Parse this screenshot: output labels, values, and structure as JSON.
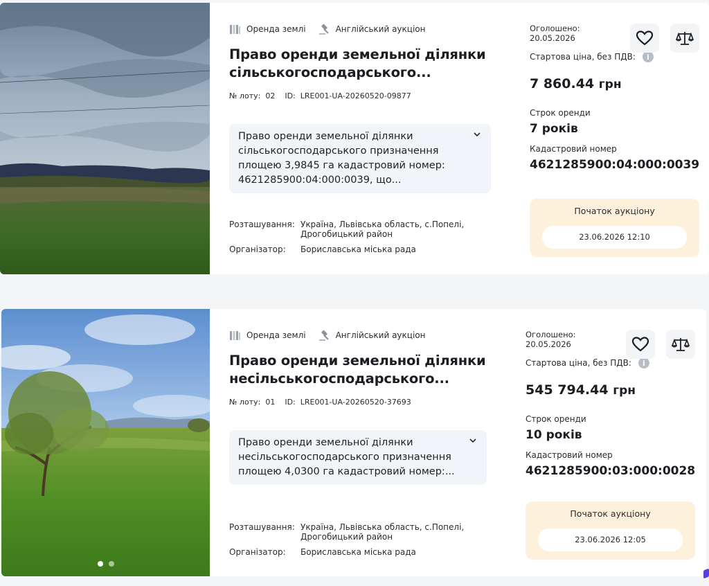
{
  "lots": [
    {
      "category": "Оренда землі",
      "auction_type": "Англійський аукціон",
      "title_line1": "Право оренди земельної ділянки",
      "title_line2": "сільськогосподарського...",
      "lot_label": "№ лоту:",
      "lot_number": "02",
      "id_label": "ID:",
      "id_value": "LRE001-UA-20260520-09877",
      "description": "Право оренди земельної ділянки сільськогосподарського призначення площею 3,9845 га кадастровий номер: 4621285900:04:000:0039, що...",
      "location_label": "Розташування:",
      "location_line1": "Україна, Львівська область, с.Попелі,",
      "location_line2": "Дрогобицький район",
      "organizer_label": "Організатор:",
      "organizer": "Бориславська міська рада",
      "announced_label": "Оголошено:",
      "announced_date": "20.05.2026",
      "start_price_label": "Стартова ціна, без ПДВ:",
      "start_price": "7 860.44",
      "currency": "грн",
      "term_label": "Строк оренди",
      "term": "7 років",
      "cadastral_label": "Кадастровий номер",
      "cadastral": "4621285900:04:000:0039",
      "auction_start_label": "Початок аукціону",
      "auction_start": "23.06.2026 12:10"
    },
    {
      "category": "Оренда землі",
      "auction_type": "Англійський аукціон",
      "title_line1": "Право оренди земельної ділянки",
      "title_line2": "несільськогосподарського...",
      "lot_label": "№ лоту:",
      "lot_number": "01",
      "id_label": "ID:",
      "id_value": "LRE001-UA-20260520-37693",
      "description": "Право оренди земельної ділянки несільськогосподарського призначення площею 4,0300 га кадастровий номер:...",
      "location_label": "Розташування:",
      "location_line1": "Україна, Львівська область, с.Попелі,",
      "location_line2": "Дрогобицький район",
      "organizer_label": "Організатор:",
      "organizer": "Бориславська міська рада",
      "announced_label": "Оголошено:",
      "announced_date": "20.05.2026",
      "start_price_label": "Стартова ціна, без ПДВ:",
      "start_price": "545 794.44",
      "currency": "грн",
      "term_label": "Строк оренди",
      "term": "10 років",
      "cadastral_label": "Кадастровий номер",
      "cadastral": "4621285900:03:000:0028",
      "auction_start_label": "Початок аукціону",
      "auction_start": "23.06.2026 12:05"
    }
  ],
  "icons": {
    "category": "land-parcel-icon",
    "auction": "gavel-icon",
    "favorite": "heart-icon",
    "compare": "scales-icon",
    "info": "info-icon",
    "expand": "chevron-down-icon"
  },
  "info_glyph": "i",
  "colors": {
    "auction_box": "#fdf1dc",
    "description_bg": "#f1f4f8",
    "action_bg": "#f3f4f6",
    "text": "#1c1d22"
  },
  "photo_carousel": {
    "images": 2,
    "active_index": 0
  }
}
